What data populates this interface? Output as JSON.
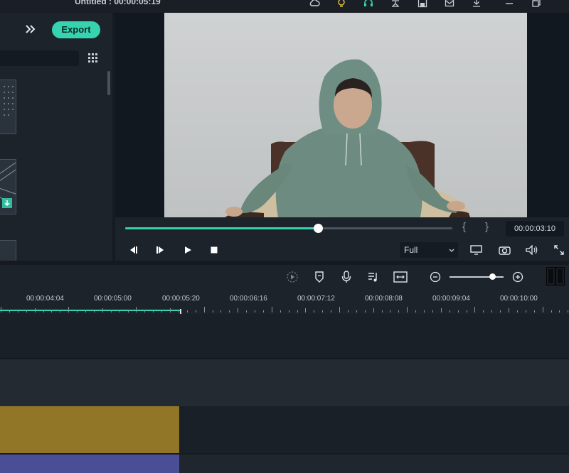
{
  "window": {
    "title": "Untitled : 00:00:05:19"
  },
  "titlebar_icons": [
    "cloud-icon",
    "lightbulb-icon",
    "headset-icon",
    "account-icon",
    "save-icon",
    "mail-icon",
    "download-icon",
    "minimize-icon",
    "restore-icon"
  ],
  "left_panel": {
    "export_label": "Export"
  },
  "player": {
    "progress_fraction": 0.59,
    "timecode": "00:00:03:10",
    "mark_in": "{",
    "mark_out": "}",
    "quality": "Full"
  },
  "timeline": {
    "ruler_labels": [
      "00:00:04:04",
      "00:00:05:00",
      "00:00:05:20",
      "00:00:06:16",
      "00:00:07:12",
      "00:00:08:08",
      "00:00:09:04",
      "00:00:10:00"
    ],
    "zoom_fraction": 0.79
  },
  "colors": {
    "accent": "#35d3b0",
    "clip_gold": "#907626",
    "clip_purple": "#4a4e96"
  }
}
